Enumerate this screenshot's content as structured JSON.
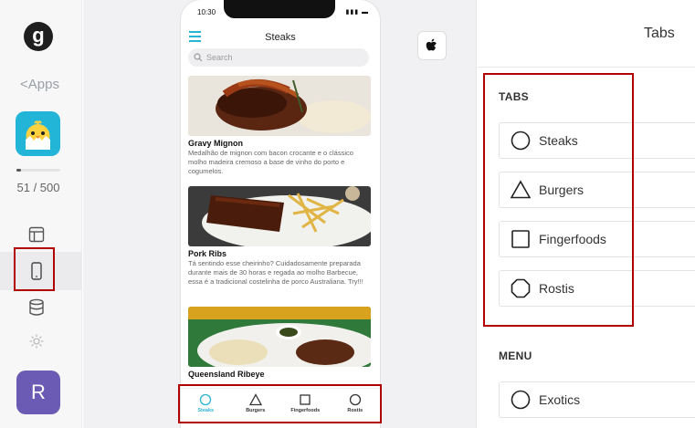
{
  "rail": {
    "logo_letter": "g",
    "apps_link": "Apps",
    "progress": {
      "count_label": "51 / 500",
      "fraction": 0.102
    },
    "avatar_letter": "R"
  },
  "phone": {
    "status_time": "10:30",
    "nav_title": "Steaks",
    "search_placeholder": "Search",
    "items": [
      {
        "title": "Gravy Mignon",
        "description": "Medalhão de mignon com bacon crocante e o clássico molho madeira cremoso a base de vinho do porto e cogumelos."
      },
      {
        "title": "Pork Ribs",
        "description": "Tá sentindo esse cheirinho? Cuidadosamente preparada durante mais de 30 horas e regada ao molho Barbecue, essa é a tradicional costelinha de porco Australiana. Try!!!"
      },
      {
        "title": "Queensland Ribeye",
        "description": ""
      }
    ],
    "tabbar": [
      {
        "label": "Steaks",
        "icon": "circle-icon",
        "active": true
      },
      {
        "label": "Burgers",
        "icon": "triangle-icon",
        "active": false
      },
      {
        "label": "Fingerfoods",
        "icon": "square-icon",
        "active": false
      },
      {
        "label": "Rostis",
        "icon": "octagon-icon",
        "active": false
      }
    ]
  },
  "panel": {
    "title": "Tabs",
    "tabs_section": "TABS",
    "tabs": [
      {
        "label": "Steaks",
        "icon": "circle-icon"
      },
      {
        "label": "Burgers",
        "icon": "triangle-icon"
      },
      {
        "label": "Fingerfoods",
        "icon": "square-icon"
      },
      {
        "label": "Rostis",
        "icon": "octagon-icon"
      }
    ],
    "menu_section": "MENU",
    "menu": [
      {
        "label": "Exotics",
        "icon": "circle-icon"
      }
    ]
  },
  "colors": {
    "accent": "#29b4d4",
    "highlight": "#b00000",
    "avatar": "#6b5bb5"
  }
}
